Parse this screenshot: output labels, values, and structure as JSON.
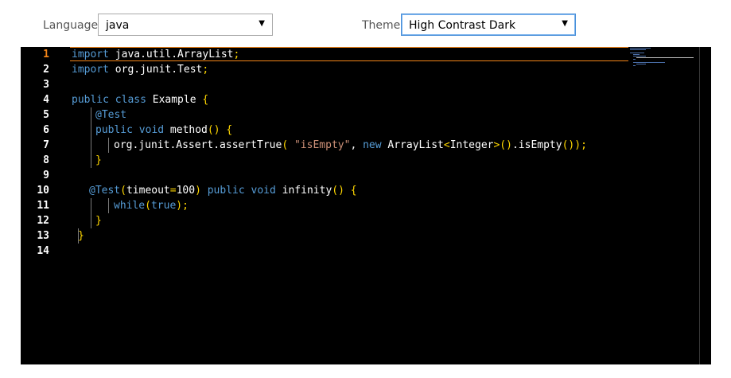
{
  "toolbar": {
    "language_label": "Language",
    "language_value": "java",
    "theme_label": "Theme",
    "theme_value": "High Contrast Dark"
  },
  "editor": {
    "line_numbers": [
      "1",
      "2",
      "3",
      "4",
      "5",
      "6",
      "7",
      "8",
      "9",
      "10",
      "11",
      "12",
      "13",
      "14"
    ],
    "current_line": 1,
    "colors": {
      "background": "#000000",
      "keyword": "#569cd6",
      "bracket": "#ffd700",
      "string": "#ce9178",
      "current_line_border": "#f38518"
    },
    "lines": [
      [
        [
          "k",
          "import"
        ],
        [
          "w",
          " java.util.ArrayList"
        ],
        [
          "b",
          ";"
        ]
      ],
      [
        [
          "k",
          "import"
        ],
        [
          "w",
          " org.junit.Test"
        ],
        [
          "b",
          ";"
        ]
      ],
      [],
      [
        [
          "k",
          "public class"
        ],
        [
          "w",
          " Example "
        ],
        [
          "b",
          "{"
        ]
      ],
      [
        [
          "k",
          "@Test"
        ]
      ],
      [
        [
          "k",
          "public void"
        ],
        [
          "w",
          " method"
        ],
        [
          "b",
          "() {"
        ]
      ],
      [
        [
          "w",
          "org.junit.Assert.assertTrue"
        ],
        [
          "b",
          "("
        ],
        [
          "w",
          " "
        ],
        [
          "s",
          "\"isEmpty\""
        ],
        [
          "w",
          ", "
        ],
        [
          "k",
          "new"
        ],
        [
          "w",
          " ArrayList"
        ],
        [
          "b",
          "<"
        ],
        [
          "w",
          "Integer"
        ],
        [
          "b",
          ">()"
        ],
        [
          "w",
          ".isEmpty"
        ],
        [
          "b",
          "());"
        ]
      ],
      [
        [
          "b",
          "}"
        ]
      ],
      [],
      [
        [
          "k",
          "@Test"
        ],
        [
          "b",
          "("
        ],
        [
          "w",
          "timeout"
        ],
        [
          "b",
          "="
        ],
        [
          "w",
          "100"
        ],
        [
          "b",
          ")"
        ],
        [
          "w",
          " "
        ],
        [
          "k",
          "public void"
        ],
        [
          "w",
          " infinity"
        ],
        [
          "b",
          "() {"
        ]
      ],
      [
        [
          "k",
          "while"
        ],
        [
          "b",
          "("
        ],
        [
          "k",
          "true"
        ],
        [
          "b",
          ");"
        ]
      ],
      [
        [
          "b",
          "}"
        ]
      ],
      [
        [
          "b",
          "}"
        ]
      ],
      []
    ]
  }
}
